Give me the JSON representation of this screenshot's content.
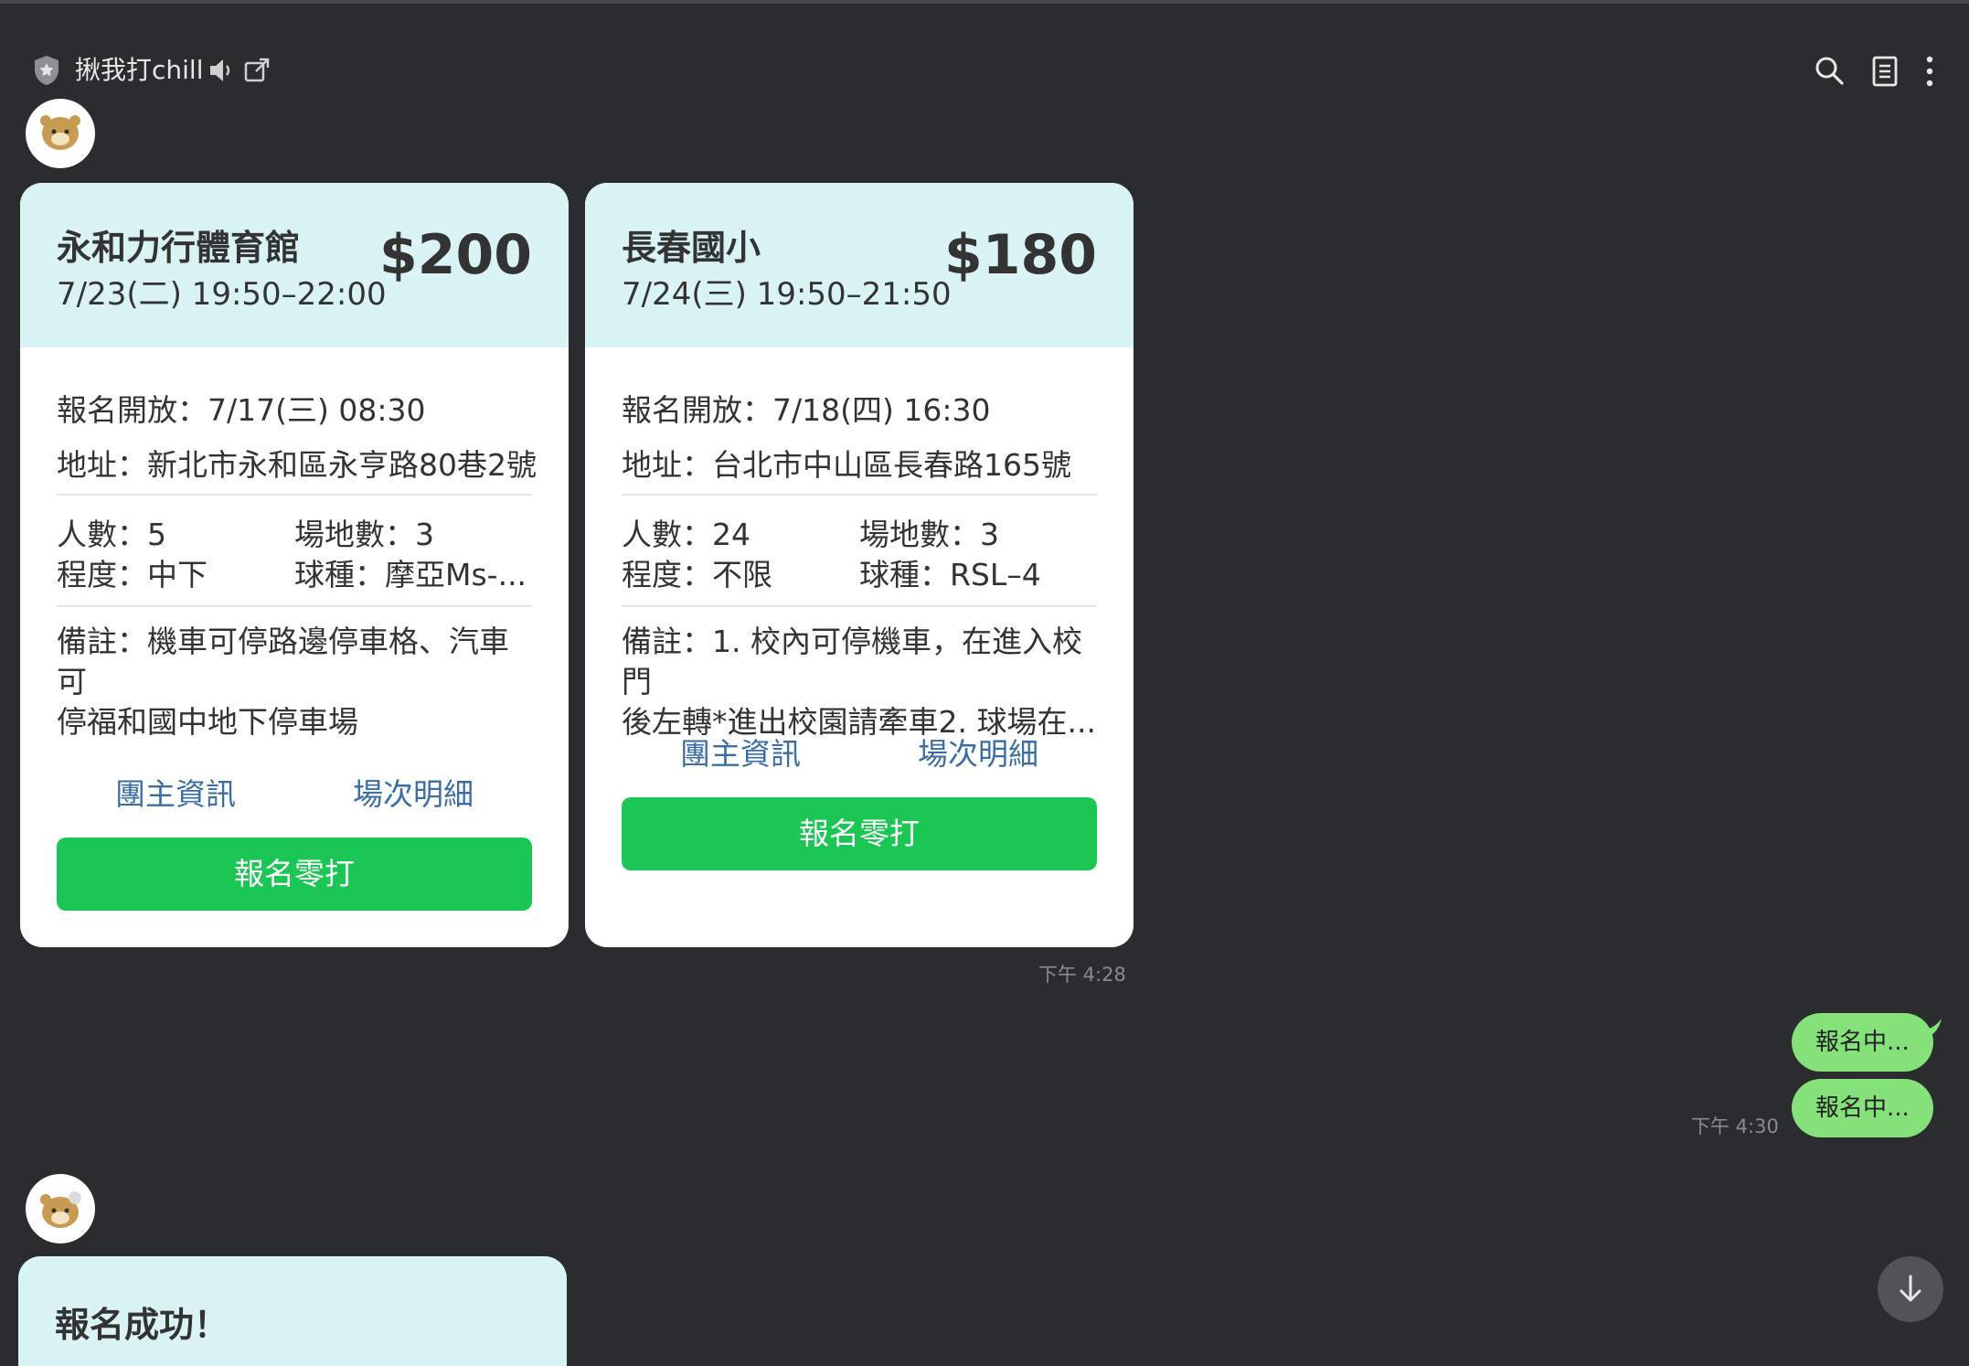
{
  "header": {
    "room_title": "揪我打chill",
    "icons": [
      "shield-star-icon",
      "speaker-icon",
      "popout-icon",
      "search-icon",
      "notes-icon",
      "more-vertical-icon"
    ]
  },
  "cards": [
    {
      "venue": "永和力行體育館",
      "time": "7/23(二) 19:50–22:00",
      "price": "$200",
      "signup_open": "報名開放：7/17(三) 08:30",
      "address": "地址：新北市永和區永亨路80巷2號",
      "players": "人數：5",
      "courts": "場地數：3",
      "level": "程度：中下",
      "ball": "球種：摩亞Ms-...",
      "note_line1": "備註：機車可停路邊停車格、汽車可",
      "note_line2": "停福和國中地下停車場",
      "host_link": "團主資訊",
      "details_link": "場次明細",
      "cta": "報名零打"
    },
    {
      "venue": "長春國小",
      "time": "7/24(三) 19:50–21:50",
      "price": "$180",
      "signup_open": "報名開放：7/18(四) 16:30",
      "address": "地址：台北市中山區長春路165號",
      "players": "人數：24",
      "courts": "場地數：3",
      "level": "程度：不限",
      "ball": "球種：RSL–4",
      "note_line1": "備註：1. 校內可停機車，在進入校門",
      "note_line2": "後左轉*進出校園請牽車2. 球場在...",
      "host_link": "團主資訊",
      "details_link": "場次明細",
      "cta": "報名零打"
    }
  ],
  "messages": {
    "cards_time": "下午 4:28",
    "user_bubble_1": "報名中...",
    "user_bubble_2": "報名中...",
    "user_time": "下午 4:30"
  },
  "result_card": {
    "title": "報名成功！"
  },
  "colors": {
    "background": "#2b2c2e",
    "card_header": "#daf3f5",
    "cta_green": "#1cc655",
    "link_blue": "#3a6ea5",
    "user_bubble": "#85e17a"
  }
}
